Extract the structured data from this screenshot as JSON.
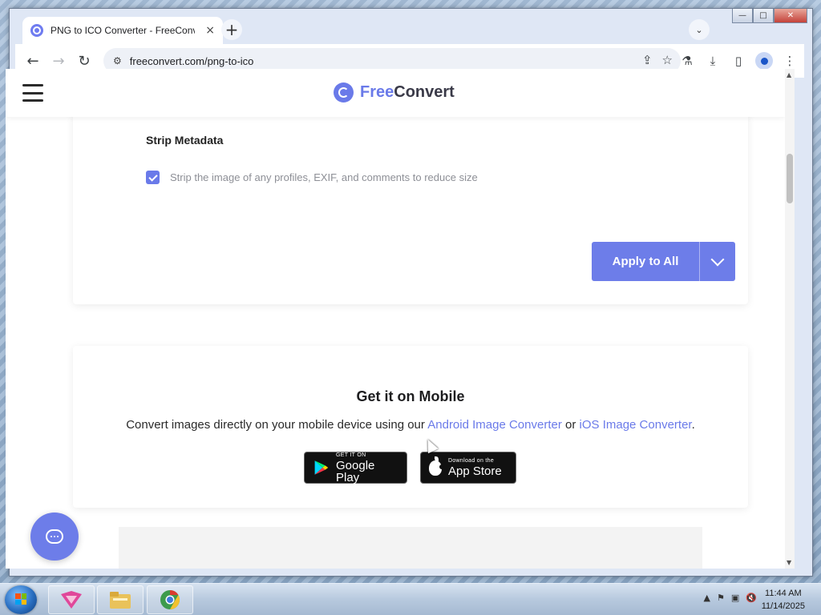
{
  "browser": {
    "tab_title": "PNG to ICO Converter - FreeConvert",
    "tab_close": "×",
    "new_tab": "+",
    "tab_search": "⌄",
    "url": "freeconvert.com/png-to-ico",
    "back": "←",
    "forward": "→",
    "reload": "↻",
    "window_controls": {
      "minimize": "—",
      "maximize": "□",
      "close": "✕"
    }
  },
  "site": {
    "brand_free": "Free",
    "brand_convert": "Convert",
    "accent_color": "#6a7ae9"
  },
  "settings": {
    "section_title": "Strip Metadata",
    "checkbox_label": "Strip the image of any profiles, EXIF, and comments to reduce size",
    "checkbox_checked": true,
    "apply_button": "Apply to All"
  },
  "mobile": {
    "title": "Get it on Mobile",
    "desc_prefix": "Convert images directly on your mobile device using our ",
    "android_link": "Android Image Converter",
    "desc_or": " or ",
    "ios_link": "iOS Image Converter",
    "desc_suffix": ".",
    "google_play_small": "GET IT ON",
    "google_play_big": "Google Play",
    "app_store_small": "Download on the",
    "app_store_big": "App Store"
  },
  "taskbar": {
    "time": "11:44 AM",
    "date": "11/14/2025"
  }
}
